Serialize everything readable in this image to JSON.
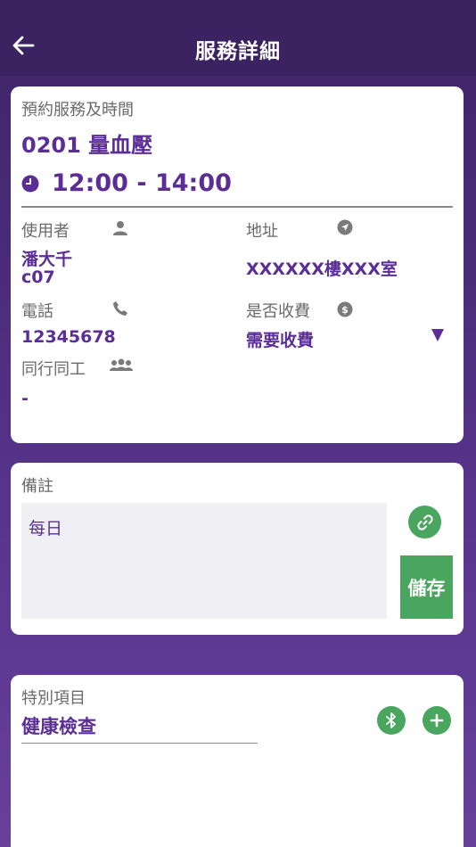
{
  "header": {
    "title": "服務詳細",
    "back_icon": "arrow-left-icon"
  },
  "booking": {
    "section_label": "預約服務及時間",
    "service": "0201 量血壓",
    "time": "12:00 - 14:00",
    "user_label": "使用者",
    "user_name": "潘大千",
    "user_code": "c07",
    "address_label": "地址",
    "address": "XXXXXX樓XXX室",
    "phone_label": "電話",
    "phone": "12345678",
    "charge_label": "是否收費",
    "charge": "需要收費",
    "companion_label": "同行同工",
    "companion": "-"
  },
  "notes": {
    "label": "備註",
    "value": "每日",
    "save_label": "儲存"
  },
  "special": {
    "label": "特別項目",
    "value": "健康檢查"
  },
  "colors": {
    "accent": "#5b2e97",
    "green": "#4aa55f",
    "header_bg": "#3b2261"
  }
}
